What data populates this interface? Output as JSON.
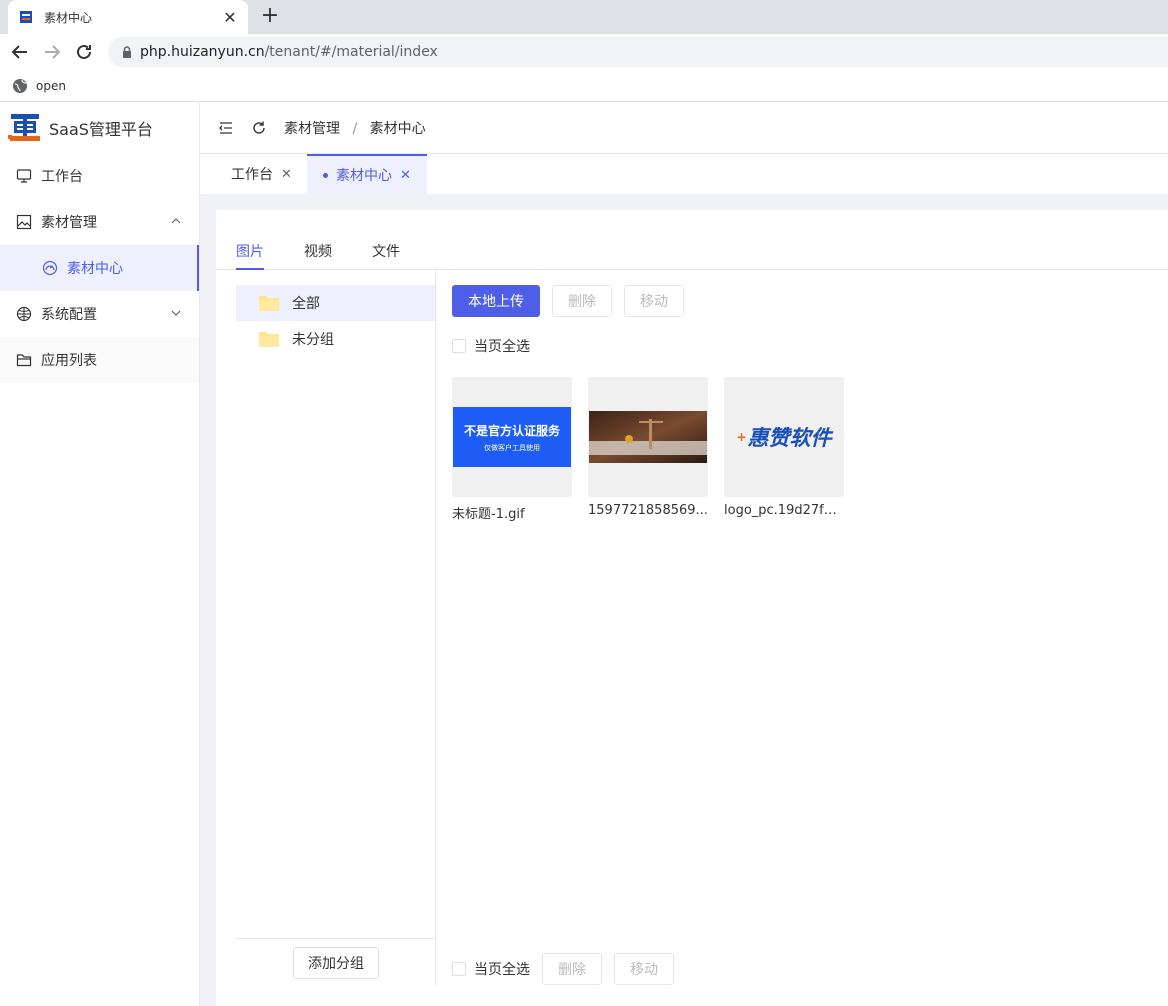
{
  "browser": {
    "tab_title": "素材中心",
    "url_host": "php.huizanyun.cn",
    "url_path": "/tenant/#/material/index",
    "bookmark": "open"
  },
  "sidebar": {
    "brand": "SaaS管理平台",
    "items": [
      {
        "label": "工作台",
        "icon": "monitor-icon"
      },
      {
        "label": "素材管理",
        "icon": "image-icon",
        "expanded": true
      },
      {
        "label": "素材中心",
        "icon": "gauge-icon",
        "active": true
      },
      {
        "label": "系统配置",
        "icon": "globe-icon"
      },
      {
        "label": "应用列表",
        "icon": "folder-icon"
      }
    ]
  },
  "breadcrumb": {
    "parent": "素材管理",
    "sep": "/",
    "current": "素材中心"
  },
  "page_tabs": [
    {
      "label": "工作台"
    },
    {
      "label": "素材中心",
      "active": true
    }
  ],
  "media_tabs": [
    "图片",
    "视频",
    "文件"
  ],
  "groups": {
    "items": [
      "全部",
      "未分组"
    ],
    "add_label": "添加分组"
  },
  "toolbar": {
    "upload": "本地上传",
    "delete": "删除",
    "move": "移动"
  },
  "select_all": "当页全选",
  "images": [
    {
      "name": "未标题-1.gif",
      "banner_title": "不是官方认证服务",
      "banner_sub": "仅做客户工具使用"
    },
    {
      "name": "1597721858569..."
    },
    {
      "name": "logo_pc.19d27f7...",
      "logo_text": "惠赞软件"
    }
  ],
  "colors": {
    "accent": "#4e5ee8",
    "banner_blue": "#1d5cf5",
    "logo_blue": "#1a4fb6",
    "logo_orange": "#e8661a"
  }
}
